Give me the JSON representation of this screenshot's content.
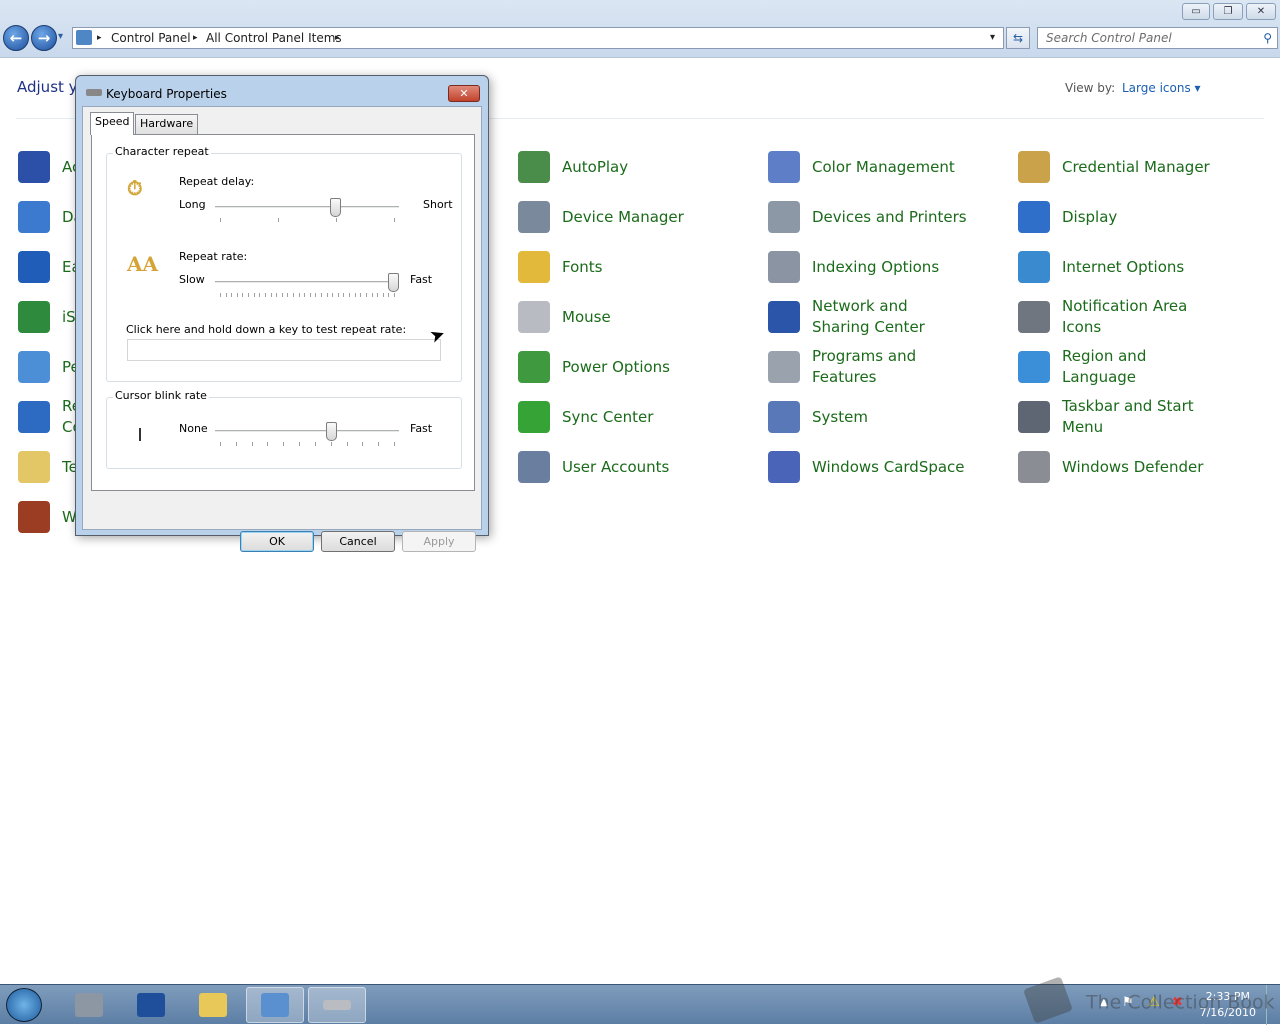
{
  "window": {
    "minimize": "▭",
    "restore": "❐",
    "close": "✕"
  },
  "nav": {
    "back": "←",
    "forward": "→",
    "recent": "▾"
  },
  "address": {
    "crumbs": [
      "Control Panel",
      "All Control Panel Items"
    ],
    "sep": "▸",
    "dropdown": "▾"
  },
  "search": {
    "placeholder": "Search Control Panel",
    "icon": "search-icon"
  },
  "heading": "Adjust y",
  "view_by": {
    "label": "View by:",
    "value": "Large icons ▾"
  },
  "left_items": [
    {
      "label": "Ac",
      "color": "#2c4fa8"
    },
    {
      "label": "Da",
      "color": "#3c7ad0"
    },
    {
      "label": "Ea",
      "color": "#1f5db8"
    },
    {
      "label": "iS",
      "color": "#2e8b3d"
    },
    {
      "label": "Pe",
      "color": "#4c8fd6"
    },
    {
      "label": "Re",
      "label2": "Co",
      "color": "#2d6bc2"
    },
    {
      "label": "Te",
      "color": "#e3c766"
    },
    {
      "label": "W",
      "color": "#9b3d22"
    }
  ],
  "items": [
    {
      "label": "AutoPlay",
      "color": "#4a8c4a"
    },
    {
      "label": "Color Management",
      "color": "#5e7fc8"
    },
    {
      "label": "Credential Manager",
      "color": "#c9a24a"
    },
    {
      "label": "Device Manager",
      "color": "#7a8a9c"
    },
    {
      "label": "Devices and Printers",
      "color": "#8d98a6"
    },
    {
      "label": "Display",
      "color": "#2f6fc9"
    },
    {
      "label": "Fonts",
      "color": "#e2b93b"
    },
    {
      "label": "Indexing Options",
      "color": "#8a94a3"
    },
    {
      "label": "Internet Options",
      "color": "#3a8ad0"
    },
    {
      "label": "Mouse",
      "color": "#b8bcc2"
    },
    {
      "label": "Network and Sharing Center",
      "color": "#2b55a8"
    },
    {
      "label": "Notification Area Icons",
      "color": "#6f7680"
    },
    {
      "label": "Power Options",
      "color": "#3f9a3f"
    },
    {
      "label": "Programs and Features",
      "color": "#9aa2ad"
    },
    {
      "label": "Region and Language",
      "color": "#3b8fd8"
    },
    {
      "label": "Sync Center",
      "color": "#36a336"
    },
    {
      "label": "System",
      "color": "#5878b8"
    },
    {
      "label": "Taskbar and Start Menu",
      "color": "#5d6672"
    },
    {
      "label": "User Accounts",
      "color": "#6a7fa0"
    },
    {
      "label": "Windows CardSpace",
      "color": "#4a64b8"
    },
    {
      "label": "Windows Defender",
      "color": "#8a8e94"
    }
  ],
  "dialog": {
    "title": "Keyboard Properties",
    "close": "✕",
    "tabs": [
      "Speed",
      "Hardware"
    ],
    "active_tab": "Speed",
    "char_repeat": {
      "title": "Character repeat",
      "delay": {
        "label": "Repeat delay:",
        "min": "Long",
        "max": "Short",
        "value": 0.667,
        "ticks": 4
      },
      "rate": {
        "label": "Repeat rate:",
        "min": "Slow",
        "max": "Fast",
        "value": 1.0,
        "ticks": 32
      },
      "test_label": "Click here and hold down a key to test repeat rate:",
      "test_value": ""
    },
    "blink": {
      "title": "Cursor blink rate",
      "min": "None",
      "max": "Fast",
      "value": 0.64,
      "ticks": 12
    },
    "buttons": {
      "ok": "OK",
      "cancel": "Cancel",
      "apply": "Apply"
    }
  },
  "taskbar": {
    "apps": [
      "start",
      "server-manager",
      "powershell",
      "explorer",
      "control-panel",
      "keyboard"
    ],
    "active": [
      "control-panel",
      "keyboard"
    ],
    "tray": [
      "show-hidden-icons",
      "action-center-flag",
      "network-warning",
      "volume-muted"
    ],
    "time": "2:33 PM",
    "date": "7/16/2010"
  },
  "watermark": "The Collection Book"
}
